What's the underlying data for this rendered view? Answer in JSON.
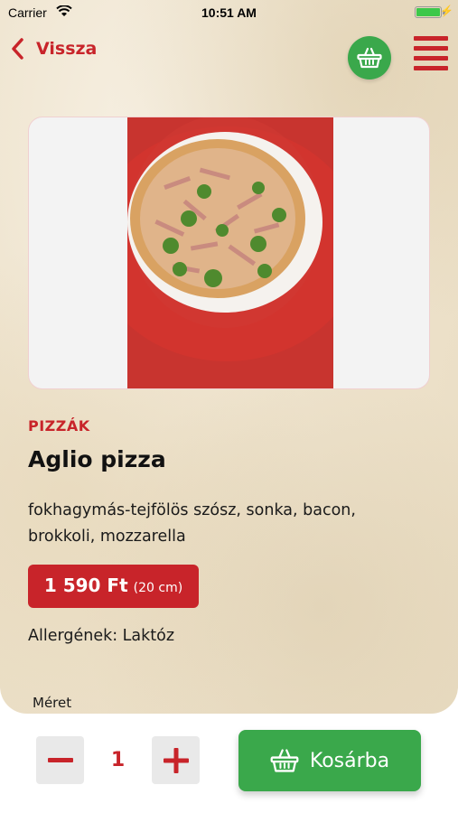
{
  "status_bar": {
    "carrier": "Carrier",
    "time": "10:51 AM"
  },
  "nav": {
    "back_label": "Vissza"
  },
  "product": {
    "category": "PIZZÁK",
    "title": "Aglio pizza",
    "description": "fokhagymás-tejfölös szósz, sonka, bacon, brokkoli, mozzarella",
    "price": "1 590 Ft",
    "size": "(20 cm)",
    "allergens": "Allergének: Laktóz",
    "size_section_label": "Méret"
  },
  "order": {
    "quantity": "1",
    "add_label": "Kosárba"
  },
  "colors": {
    "brand_red": "#c8242a",
    "accent_green": "#3aa84b"
  }
}
